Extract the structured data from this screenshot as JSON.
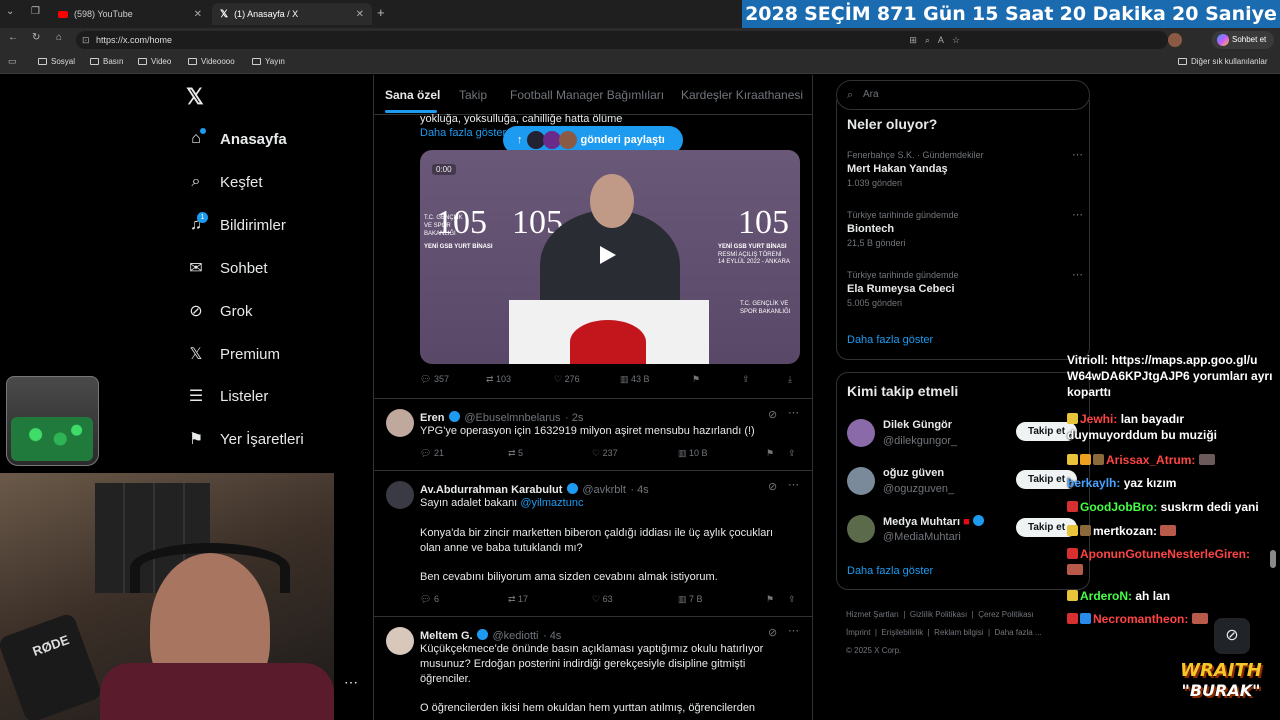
{
  "browser": {
    "tabs": [
      {
        "label": "(598) YouTube",
        "icon": "youtube-icon",
        "color": "#ff0000"
      },
      {
        "label": "(1) Anasayfa / X",
        "icon": "x-logo-icon",
        "color": "#ffffff"
      }
    ],
    "url": "https://x.com/home",
    "copilot_label": "Sohbet et",
    "bookmarks": [
      "Sosyal",
      "Basın",
      "Video",
      "Videoooo",
      "Yayın"
    ],
    "other_bookmarks": "Diğer sık kullanılanlar"
  },
  "countdown": {
    "year": "2028",
    "label": "SEÇİM",
    "days": "871 Gün",
    "hours": "15 Saat",
    "minutes": "20 Dakika",
    "seconds": "20 Saniye",
    "bg": "#1b6bb0"
  },
  "sidebar": {
    "items": [
      {
        "label": "Anasayfa",
        "icon": "home-icon"
      },
      {
        "label": "Keşfet",
        "icon": "search-icon"
      },
      {
        "label": "Bildirimler",
        "icon": "bell-icon",
        "badge": "1"
      },
      {
        "label": "Sohbet",
        "icon": "mail-icon"
      },
      {
        "label": "Grok",
        "icon": "grok-icon"
      },
      {
        "label": "Premium",
        "icon": "x-logo-icon"
      },
      {
        "label": "Listeler",
        "icon": "list-icon"
      },
      {
        "label": "Yer İşaretleri",
        "icon": "bookmark-icon"
      }
    ]
  },
  "feed": {
    "tabs": [
      "Sana özel",
      "Takip",
      "Football Manager Bağımlıları",
      "Kardeşler Kıraathanesi"
    ],
    "partial_text": "yokluğa, yoksulluğa, cahilliğe hatta ölüme",
    "show_more": "Daha fazla göster",
    "new_posts_pill": "gönderi paylaştı",
    "video": {
      "line1": "105",
      "line2": "YENİ GSB YURT BİNASI",
      "line3": "RESMİ AÇILIŞ TÖRENİ",
      "line4": "14 EYLÜL 2022 - ANKARA",
      "side": "T.C. GENÇLİK VE SPOR BAKANLIĞI",
      "time": "0:00"
    },
    "video_stats": {
      "replies": "357",
      "reposts": "103",
      "likes": "276",
      "views": "43 B"
    },
    "posts": [
      {
        "name": "Eren",
        "handle": "@Ebuselmnbelarus",
        "time": "· 2s",
        "text": [
          "YPG'ye operasyon için 1632919 milyon aşiret mensubu hazırlandı (!)"
        ],
        "replies": "21",
        "reposts": "5",
        "likes": "237",
        "views": "10 B"
      },
      {
        "name": "Av.Abdurrahman Karabulut",
        "handle": "@avkrblt",
        "time": "· 4s",
        "text": [
          "Sayın adalet bakanı",
          "Konya'da bir zincir marketten biberon çaldığı iddiası ile üç aylık çocukları",
          "olan anne ve baba tutuklandı mı?",
          "Ben cevabını biliyorum ama sizden cevabını almak istiyorum."
        ],
        "mention": "@yilmaztunc",
        "replies": "6",
        "reposts": "17",
        "likes": "63",
        "views": "7 B"
      },
      {
        "name": "Meltem G.",
        "handle": "@kediotti",
        "time": "· 4s",
        "text": [
          "Küçükçekmece'de önünde basın açıklaması yaptığımız okulu hatırlıyor",
          "musunuz? Erdoğan posterini indirdiği gerekçesiyle disipline gitmişti",
          "öğrenciler.",
          "O öğrencilerden ikisi hem okuldan hem yurttan atılmış, öğrencilerden"
        ]
      }
    ]
  },
  "right": {
    "search_placeholder": "Ara",
    "trends_title": "Neler oluyor?",
    "trends": [
      {
        "category": "Fenerbahçe S.K. · Gündemdekiler",
        "name": "Mert Hakan Yandaş",
        "count": "1.039 gönderi"
      },
      {
        "category": "Türkiye tarihinde gündemde",
        "name": "Biontech",
        "count": "21,5 B gönderi"
      },
      {
        "category": "Türkiye tarihinde gündemde",
        "name": "Ela Rumeysa Cebeci",
        "count": "5.005 gönderi"
      }
    ],
    "show_more": "Daha fazla göster",
    "follow_title": "Kimi takip etmeli",
    "follow_label": "Takip et",
    "suggestions": [
      {
        "name": "Dilek Güngör",
        "handle": "@dilekgungor_"
      },
      {
        "name": "oğuz güven",
        "handle": "@oguzguven_"
      },
      {
        "name": "Medya Muhtarı",
        "handle": "@MediaMuhtari"
      }
    ],
    "footer": [
      "Hizmet Şartları",
      "Gizlilik Politikası",
      "Çerez Politikası",
      "İmprint",
      "Erişilebilirlik",
      "Reklam bilgisi",
      "Daha fazla ...",
      "© 2025 X Corp."
    ]
  },
  "chat": [
    {
      "user": "Vitrioll:",
      "msg": "https://maps.app.goo.gl/u W64wDA6KPJtgAJP6 yorumları ayrı koparttı",
      "color": "#ffffff"
    },
    {
      "user": "Jewhi:",
      "msg": "lan bayadır duymuyorddum bu muziği",
      "color": "#ff4444"
    },
    {
      "user": "Arissax_Atrum:",
      "msg": "",
      "color": "#ff4444"
    },
    {
      "user": "berkaylh:",
      "msg": "yaz kızım",
      "color": "#4aa3ff"
    },
    {
      "user": "GoodJobBro:",
      "msg": "suskrm dedi yani",
      "color": "#44ff44"
    },
    {
      "user": "mertkozan:",
      "msg": "",
      "color": "#ffffff"
    },
    {
      "user": "AponunGotuneNesterleGiren:",
      "msg": "",
      "color": "#ff4444"
    },
    {
      "user": "ArderoN:",
      "msg": "ah lan",
      "color": "#44ff44"
    },
    {
      "user": "Necromantheon:",
      "msg": "",
      "color": "#ff4444"
    }
  ],
  "stream": {
    "logo_line1": "WRAITH",
    "logo_line2": "\"BURAK\"",
    "mic_label": "RØDE"
  }
}
